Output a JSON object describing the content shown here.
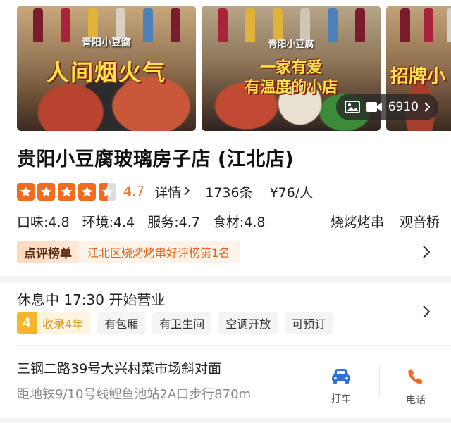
{
  "gallery": {
    "photos": [
      {
        "caption_small": "青阳小豆腐",
        "caption_big": "人间烟火气"
      },
      {
        "caption_small": "青阳小豆腐",
        "caption_big": "一家有爱",
        "caption_big2": "有温度的小店"
      },
      {
        "caption_big": "招牌小"
      }
    ],
    "media_count": "6910"
  },
  "shop": {
    "name": "贵阳小豆腐玻璃房子店 (江北店)",
    "score": "4.7",
    "stars": 4.5,
    "detail_label": "详情",
    "reviews": "1736条",
    "price": "¥76/人"
  },
  "subscores": [
    {
      "label": "口味:4.8"
    },
    {
      "label": "环境:4.4"
    },
    {
      "label": "服务:4.7"
    },
    {
      "label": "食材:4.8"
    }
  ],
  "category_tags": [
    "烧烤烤串",
    "观音桥"
  ],
  "ranking": {
    "badge": "点评榜单",
    "text": "江北区烧烤烤串好评榜第1名"
  },
  "status": {
    "text": "休息中 17:30 开始营业",
    "years_num": "4",
    "years_label": "收录4年",
    "facilities": [
      "有包厢",
      "有卫生间",
      "空调开放",
      "可预订"
    ]
  },
  "location": {
    "address": "三钢二路39号大兴村菜市场斜对面",
    "metro": "距地铁9/10号线鲤鱼池站2A口步行870m"
  },
  "actions": {
    "taxi_label": "打车",
    "phone_label": "电话"
  },
  "colors": {
    "accent": "#f26b21",
    "rank_text": "#e2621b",
    "taxi_icon": "#2f6fe0",
    "phone_icon": "#f26b21"
  }
}
